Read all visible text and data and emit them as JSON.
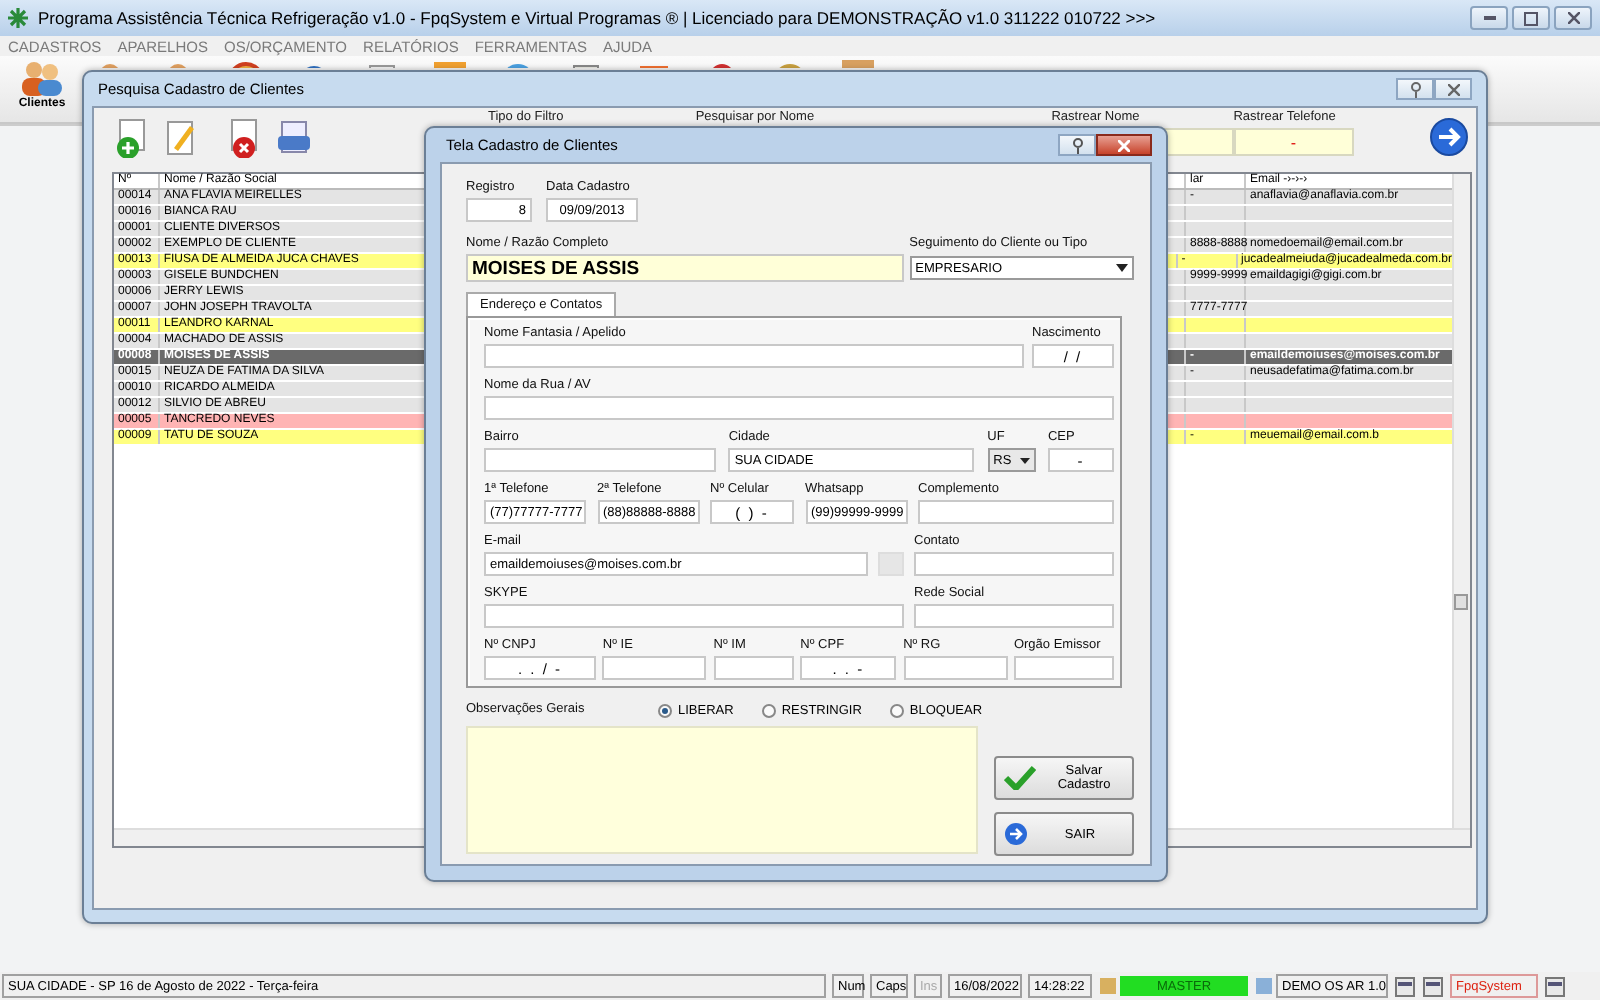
{
  "app_window": {
    "title": "Programa Assistência Técnica Refrigeração v1.0 - FpqSystem e Virtual Programas ® | Licenciado para  DEMONSTRAÇÃO v1.0 311222 010722 >>>"
  },
  "menu": [
    "CADASTROS",
    "APARELHOS",
    "OS/ORÇAMENTO",
    "RELATÓRIOS",
    "FERRAMENTAS",
    "AJUDA"
  ],
  "toolbar": {
    "label": "Clientes"
  },
  "search_window": {
    "title": "Pesquisa Cadastro de Clientes",
    "filters": [
      {
        "label": "Tipo do Filtro",
        "kind": "hidden"
      },
      {
        "label": "Pesquisar por Nome",
        "kind": "hidden"
      },
      {
        "label": "Rastrear Nome",
        "kind": "field"
      },
      {
        "label": "Rastrear Telefone",
        "kind": "field",
        "value": "-"
      }
    ],
    "table": {
      "columns": [
        "Nº",
        "Nome / Razão Social",
        "lar",
        "Email -›-›-›"
      ],
      "rows": [
        {
          "number": "00014",
          "name": "ANA FLAVIA MEIRELLES",
          "column_3": "-",
          "email": "anaflavia@anaflavia.com.br",
          "color": "#e4e4e4",
          "selected": false
        },
        {
          "number": "00016",
          "name": "BIANCA RAU",
          "color": "#e4e4e4",
          "selected": false
        },
        {
          "number": "00001",
          "name": "CLIENTE DIVERSOS",
          "color": "#e4e4e4",
          "selected": false
        },
        {
          "number": "00002",
          "name": "EXEMPLO DE CLIENTE",
          "column_3": "8888-8888",
          "email": "nomedoemail@email.com.br",
          "color": "#e4e4e4",
          "selected": false
        },
        {
          "number": "00013",
          "name": "FIUSA DE ALMEIDA JUCA CHAVES",
          "column_3": "-",
          "email": "jucadealmeiuda@jucadealmeda.com.br",
          "color": "#ffff80",
          "selected": false
        },
        {
          "number": "00003",
          "name": "GISELE BUNDCHEN",
          "column_3": "9999-9999",
          "email": "emaildagigi@gigi.com.br",
          "color": "#e4e4e4",
          "selected": false
        },
        {
          "number": "00006",
          "name": "JERRY LEWIS",
          "color": "#e4e4e4",
          "selected": false
        },
        {
          "number": "00007",
          "name": "JOHN JOSEPH TRAVOLTA",
          "column_3": "7777-7777",
          "color": "#e4e4e4",
          "selected": false
        },
        {
          "number": "00011",
          "name": "LEANDRO KARNAL",
          "color": "#ffff80",
          "selected": false
        },
        {
          "number": "00004",
          "name": "MACHADO DE ASSIS",
          "color": "#e4e4e4",
          "selected": false
        },
        {
          "number": "00008",
          "name": "MOISES DE ASSIS",
          "column_3": "-",
          "email": "emaildemoiuses@moises.com.br",
          "color": "#6a6a6a",
          "selected": true
        },
        {
          "number": "00015",
          "name": "NEUZA DE FATIMA DA SILVA",
          "column_3": "-",
          "email": "neusadefatima@fatima.com.br",
          "color": "#e4e4e4",
          "selected": false
        },
        {
          "number": "00010",
          "name": "RICARDO ALMEIDA",
          "color": "#e4e4e4",
          "selected": false
        },
        {
          "number": "00012",
          "name": "SILVIO DE ABREU",
          "color": "#e4e4e4",
          "selected": false
        },
        {
          "number": "00005",
          "name": "TANCREDO NEVES",
          "color": "#ffb4b4",
          "selected": false
        },
        {
          "number": "00009",
          "name": "TATU DE SOUZA",
          "column_3": "-",
          "email": "meuemail@email.com.b",
          "color": "#ffff80",
          "selected": false
        }
      ]
    }
  },
  "dialog": {
    "title": "Tela Cadastro de Clientes",
    "registro": {
      "label": "Registro",
      "value": "8"
    },
    "data_cadastro": {
      "label": "Data Cadastro",
      "value": "09/09/2013"
    },
    "nome": {
      "label": "Nome / Razão Completo",
      "value": "MOISES DE ASSIS"
    },
    "segmento": {
      "label": "Seguimento do Cliente ou Tipo",
      "value": "EMPRESARIO"
    },
    "tabs": [
      {
        "label": "Endereço e Contatos",
        "selected": true
      }
    ],
    "field_rows": [
      {
        "fields": [
          {
            "label": "Nome Fantasia / Apelido",
            "kind": "text"
          },
          {
            "label": "Nascimento",
            "kind": "masked",
            "value": "/ /"
          }
        ]
      },
      {
        "fields": [
          {
            "label": "Nome da Rua / AV",
            "kind": "text"
          }
        ]
      },
      {
        "fields": [
          {
            "label": "Bairro",
            "kind": "text"
          },
          {
            "label": "Cidade",
            "kind": "text",
            "value": "SUA CIDADE"
          },
          {
            "label": "UF",
            "kind": "select",
            "value": "RS"
          },
          {
            "label": "CEP",
            "kind": "masked",
            "value": "-"
          }
        ]
      },
      {
        "fields": [
          {
            "label": "1ª Telefone",
            "kind": "text",
            "value": "(77)77777-7777"
          },
          {
            "label": "2ª Telefone",
            "kind": "text",
            "value": "(88)88888-8888"
          },
          {
            "label": "Nº Celular",
            "kind": "masked",
            "value": "( )  -"
          },
          {
            "label": "Whatsapp",
            "kind": "text",
            "value": "(99)99999-9999"
          },
          {
            "label": "Complemento",
            "kind": "text"
          }
        ]
      },
      {
        "fields": [
          {
            "label": "E-mail",
            "kind": "text",
            "value": "emaildemoiuses@moises.com.br"
          },
          {
            "kind": "swatch"
          },
          {
            "label": "Contato",
            "kind": "text"
          }
        ]
      },
      {
        "fields": [
          {
            "label": "SKYPE",
            "kind": "text"
          },
          {
            "label": "Rede Social",
            "kind": "text"
          }
        ]
      },
      {
        "fields": [
          {
            "label": "Nº CNPJ",
            "kind": "masked",
            "value": ". . / -"
          },
          {
            "label": "Nº IE",
            "kind": "text"
          },
          {
            "label": "Nº IM",
            "kind": "text"
          },
          {
            "label": "Nº CPF",
            "kind": "masked",
            "value": ". . -"
          },
          {
            "label": "Nº RG",
            "kind": "text"
          },
          {
            "label": "Orgão Emissor",
            "kind": "text"
          }
        ]
      }
    ],
    "observacoes": {
      "label": "Observações Gerais"
    },
    "radios": [
      {
        "label": "LIBERAR",
        "selected": true
      },
      {
        "label": "RESTRINGIR",
        "selected": false
      },
      {
        "label": "BLOQUEAR",
        "selected": false
      }
    ],
    "buttons": [
      {
        "label": "Salvar Cadastro",
        "kind": "save"
      },
      {
        "label": "SAIR",
        "kind": "exit"
      }
    ]
  },
  "status_bar": [
    {
      "kind": "text",
      "text": "SUA CIDADE - SP 16 de Agosto de 2022 - Terça-feira",
      "disabled": false
    },
    {
      "kind": "text",
      "text": "Num",
      "disabled": false
    },
    {
      "kind": "text",
      "text": "Caps",
      "disabled": false
    },
    {
      "kind": "text",
      "text": "Ins",
      "disabled": true
    },
    {
      "kind": "text",
      "text": "16/08/2022",
      "disabled": false
    },
    {
      "kind": "text",
      "text": "14:28:22",
      "disabled": false
    },
    {
      "kind": "meter",
      "text": "MASTER"
    },
    {
      "kind": "icon_text",
      "text": "DEMO OS AR 1.0"
    },
    {
      "kind": "icon"
    },
    {
      "kind": "icon"
    },
    {
      "kind": "brand",
      "text": "FpqSystem"
    },
    {
      "kind": "icon"
    }
  ]
}
